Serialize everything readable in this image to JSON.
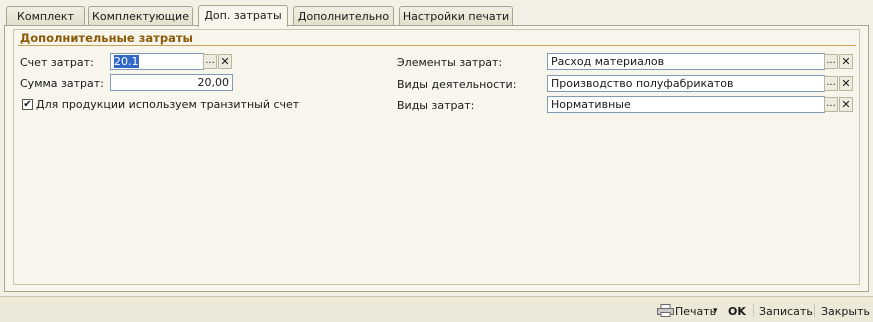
{
  "tabs": [
    {
      "label": "Комплект",
      "active": false
    },
    {
      "label": "Комплектующие",
      "active": false
    },
    {
      "label": "Доп. затраты",
      "active": true
    },
    {
      "label": "Дополнительно",
      "active": false
    },
    {
      "label": "Настройки печати",
      "active": false
    }
  ],
  "group": {
    "title": "Дополнительные затраты"
  },
  "left": {
    "account_label": "Счет затрат:",
    "account_value": "20.1",
    "sum_label": "Сумма затрат:",
    "sum_value": "20,00",
    "checkbox_label": "Для продукции используем транзитный счет",
    "checkbox_checked": true
  },
  "right": {
    "elements_label": "Элементы затрат:",
    "elements_value": "Расход материалов",
    "activity_label": "Виды деятельности:",
    "activity_value": "Производство полуфабрикатов",
    "cost_types_label": "Виды затрат:",
    "cost_types_value": "Нормативные"
  },
  "buttons": {
    "ellipsis": "...",
    "clear": "✕",
    "check_mark": "✔"
  },
  "footer": {
    "print_label": "Печать",
    "print_arrow": "▾",
    "ok_label": "OK",
    "save_label": "Записать",
    "close_label": "Закрыть"
  },
  "colors": {
    "group_title": "#8a5a08",
    "selection": "#3168c8",
    "field_border": "#7f9db9"
  }
}
